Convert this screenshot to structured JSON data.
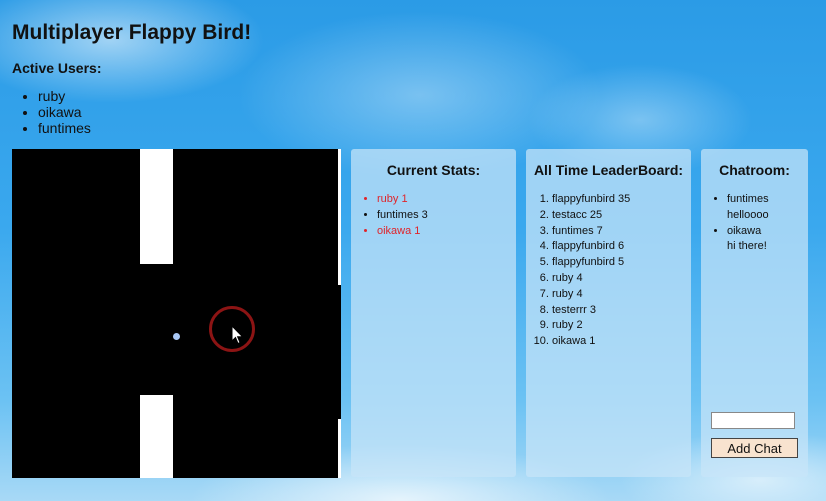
{
  "page": {
    "title": "Multiplayer Flappy Bird!",
    "active_users_label": "Active Users:",
    "active_users": [
      "ruby",
      "oikawa",
      "funtimes"
    ]
  },
  "game": {
    "background": "#000000",
    "pipe_color": "#ffffff"
  },
  "stats": {
    "title": "Current Stats:",
    "items": [
      {
        "text": "ruby 1",
        "color": "#e0242a"
      },
      {
        "text": "funtimes 3",
        "color": "#111111"
      },
      {
        "text": "oikawa 1",
        "color": "#e0242a"
      }
    ]
  },
  "leaderboard": {
    "title": "All Time LeaderBoard:",
    "items": [
      "flappyfunbird 35",
      "testacc 25",
      "funtimes 7",
      "flappyfunbird 6",
      "flappyfunbird 5",
      "ruby 4",
      "ruby 4",
      "testerrr 3",
      "ruby 2",
      "oikawa 1"
    ]
  },
  "chat": {
    "title": "Chatroom:",
    "messages": [
      {
        "user": "funtimes",
        "text": "helloooo"
      },
      {
        "user": "oikawa",
        "text": "hi there!"
      }
    ],
    "input_value": "",
    "button_label": "Add Chat"
  }
}
